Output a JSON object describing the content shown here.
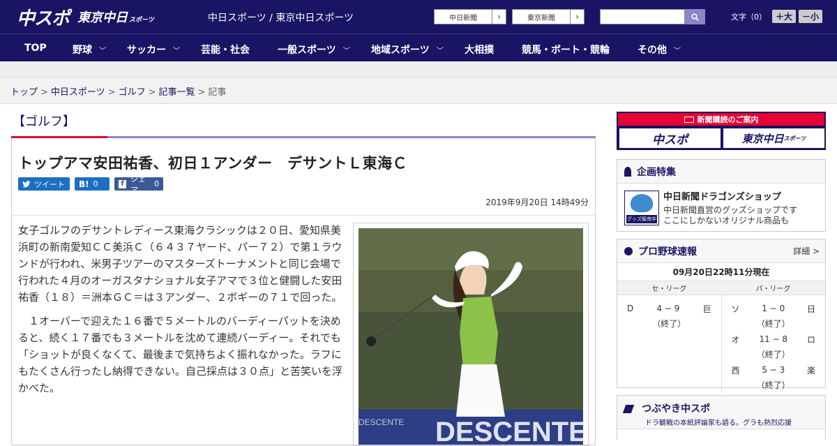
{
  "header": {
    "logo_chunichi": "中スポ",
    "logo_tokyo": "東京中日",
    "logo_tokyo_sub": "スポーツ",
    "site_title": "中日スポーツ / 東京中日スポーツ",
    "paper_links": [
      {
        "label": "中日新聞",
        "arrow": "›"
      },
      {
        "label": "東京新聞",
        "arrow": "›"
      }
    ],
    "font_size_label": "文字（0）",
    "font_bigger": "＋大",
    "font_smaller": "－小"
  },
  "nav": {
    "items": [
      {
        "label": "TOP",
        "has_menu": false
      },
      {
        "label": "野球",
        "has_menu": true
      },
      {
        "label": "サッカー",
        "has_menu": true
      },
      {
        "label": "芸能・社会",
        "has_menu": false
      },
      {
        "label": "一般スポーツ",
        "has_menu": true
      },
      {
        "label": "地域スポーツ",
        "has_menu": true
      },
      {
        "label": "大相撲",
        "has_menu": false
      },
      {
        "label": "競馬・ボート・競輪",
        "has_menu": false
      },
      {
        "label": "その他",
        "has_menu": true
      }
    ]
  },
  "breadcrumb": {
    "items": [
      "トップ",
      "中日スポーツ",
      "ゴルフ",
      "記事一覧"
    ],
    "current": "記事",
    "separator": ">"
  },
  "article": {
    "category": "【ゴルフ】",
    "headline": "トップアマ安田祐香、初日１アンダー　デサントＬ東海Ｃ",
    "share": {
      "tweet": "ツイート",
      "hatena": "B!",
      "hatena_count": "0",
      "facebook": "シェア",
      "facebook_count": "0"
    },
    "date": "2019年9月20日 14時49分",
    "paragraphs": [
      "女子ゴルフのデサントレディース東海クラシックは２０日、愛知県美浜町の新南愛知ＣＣ美浜Ｃ（６４３７ヤード、パー７２）で第１ラウンドが行われ、米男子ツアーのマスターズトーナメントと同じ会場で行われた４月のオーガスタナショナル女子アマで３位と健闘した安田祐香（１８）＝洲本ＧＣ＝は３アンダー、２ボギーの７１で回った。",
      "　１オーバーで迎えた１６番で５メートルのバーディーパットを決めると、続く１７番でも３メートルを沈めて連続バーディー。それでも「ショットが良くなくて、最後まで気持ちよく振れなかった。ラフにもたくさん行ったし納得できない。自己採点は３０点」と苦笑いを浮かべた。"
    ]
  },
  "sidebar": {
    "subscription": {
      "title": "新聞購読のご案内",
      "btn_chunichi": "中スポ",
      "btn_tokyo": "東京中日",
      "btn_tokyo_sub": "スポーツ"
    },
    "special": {
      "title": "企画特集",
      "shop_title": "中日新聞ドラゴンズショップ",
      "shop_desc1": "中日新聞直営のグッズショップです",
      "shop_desc2": "ここにしかないオリジナル商品も",
      "badge": "グッズ販売中"
    },
    "baseball": {
      "title": "プロ野球速報",
      "more": "詳細 >",
      "timestamp": "09月20日22時11分現在",
      "central_label": "セ・リーグ",
      "pacific_label": "パ・リーグ",
      "central": [
        {
          "home": "D",
          "score": "4 − 9",
          "away": "巨",
          "status": "（終了）"
        }
      ],
      "pacific": [
        {
          "home": "ソ",
          "score": "1 − 0",
          "away": "日",
          "status": "（終了）"
        },
        {
          "home": "オ",
          "score": "11 − 8",
          "away": "ロ",
          "status": "（終了）"
        },
        {
          "home": "西",
          "score": "5 − 3",
          "away": "楽",
          "status": "（終了）"
        }
      ]
    },
    "tweets": {
      "title": "つぶやき中スポ",
      "subtitle": "ドラ観戦の本紙評論家も語る。グラも熱烈応援"
    }
  }
}
